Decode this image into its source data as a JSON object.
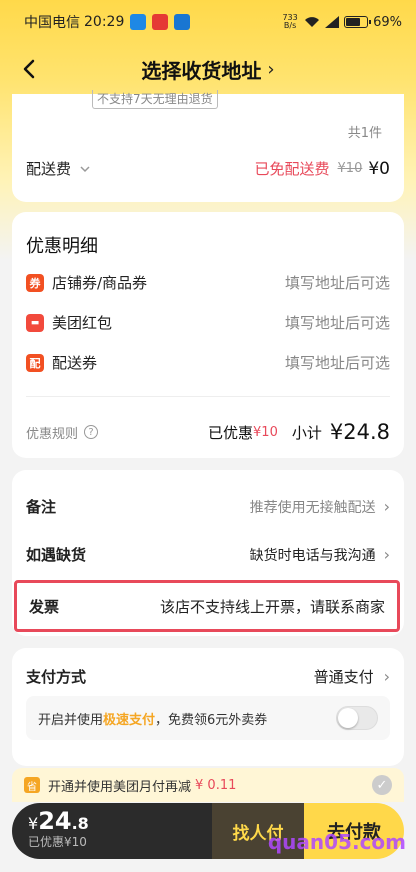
{
  "status_bar": {
    "carrier": "中国电信",
    "time": "20:29",
    "net_speed": "733",
    "net_unit": "B/s",
    "battery": "69%"
  },
  "nav": {
    "title": "选择收货地址",
    "chevron": "›"
  },
  "order": {
    "partial_tag": "不支持7天无理由退货",
    "count": "共1件",
    "delivery_label": "配送费",
    "delivery_free": "已免配送费",
    "delivery_original": "¥10",
    "delivery_price": "¥0"
  },
  "discount": {
    "title": "优惠明细",
    "items": [
      {
        "icon": "券",
        "label": "店铺券/商品券",
        "value": "填写地址后可选"
      },
      {
        "icon": "包",
        "label": "美团红包",
        "value": "填写地址后可选"
      },
      {
        "icon": "配",
        "label": "配送券",
        "value": "填写地址后可选"
      }
    ],
    "rules_label": "优惠规则",
    "saved_label": "已优惠",
    "saved_value": "¥10",
    "subtotal_label": "小计",
    "subtotal_value": "¥24.8"
  },
  "notes": {
    "remark_label": "备注",
    "remark_value": "推荐使用无接触配送",
    "stockout_label": "如遇缺货",
    "stockout_value": "缺货时电话与我沟通",
    "invoice_label": "发票",
    "invoice_value": "该店不支持线上开票，请联系商家"
  },
  "payment": {
    "label": "支付方式",
    "value": "普通支付",
    "fast_prefix": "开启并使用",
    "fast_highlight": "极速支付",
    "fast_suffix": "，免费领6元外卖券",
    "fast_enabled": false
  },
  "promo": {
    "icon": "省",
    "text": "开通并使用美团月付再减",
    "amount": "¥ 0.11"
  },
  "paybar": {
    "currency": "¥",
    "amount_int": "24",
    "amount_dec": ".8",
    "saved": "已优惠¥10",
    "friend_pay": "找人付",
    "pay": "去付款"
  },
  "watermark": "quan05.com",
  "colors": {
    "accent_yellow": "#ffd84a",
    "discount_red": "#e8495a",
    "highlight_orange": "#f5a623"
  }
}
